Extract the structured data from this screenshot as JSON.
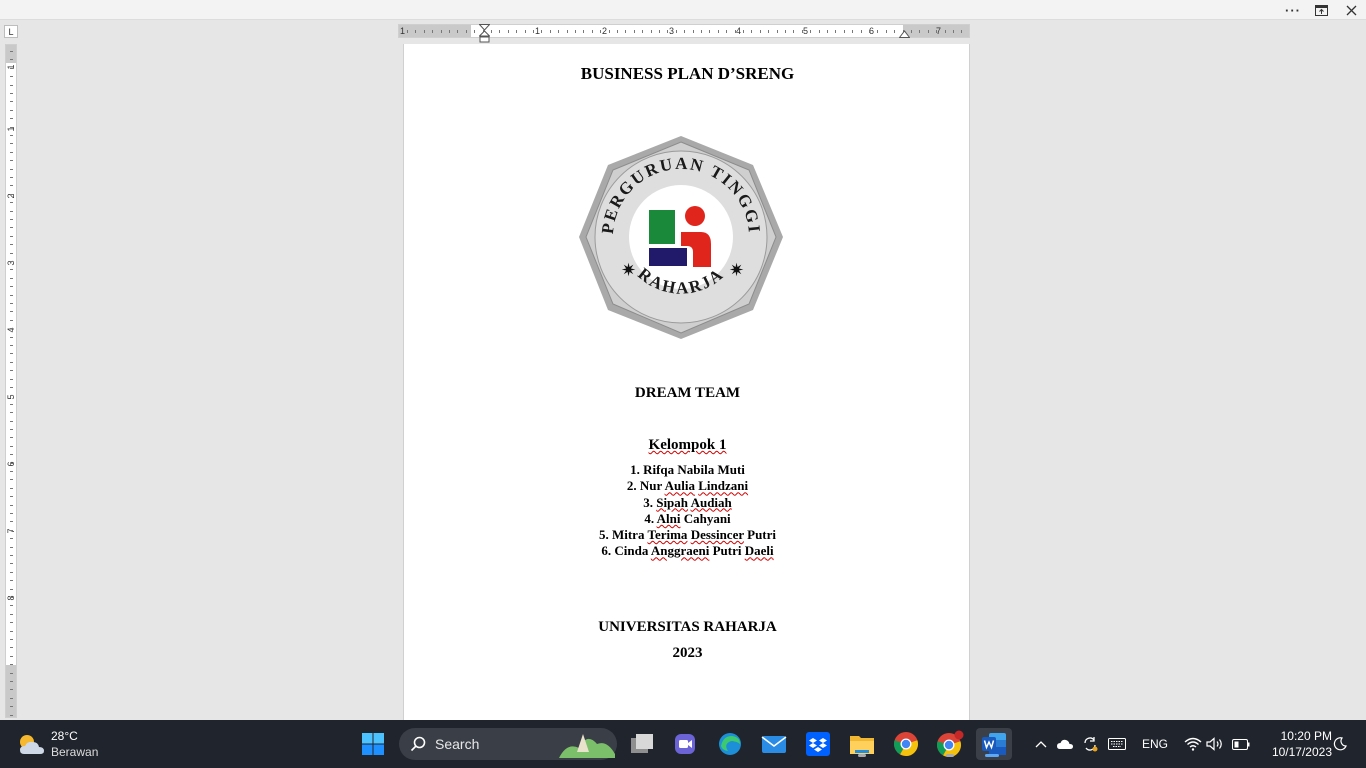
{
  "window": {
    "more_label": "···",
    "restore_icon": "restore-icon",
    "close_icon": "close-icon"
  },
  "ruler": {
    "corner_label": "L",
    "h_numbers": [
      "1",
      "1",
      "2",
      "3",
      "4",
      "5",
      "6",
      "7"
    ],
    "v_numbers": [
      "1",
      "1",
      "2",
      "3",
      "4",
      "5",
      "6",
      "7",
      "8"
    ]
  },
  "document": {
    "title": "BUSINESS PLAN D’SRENG",
    "logo": {
      "top_text": "PERGURUAN TINGGI",
      "bottom_text": "RAHARJA",
      "colors": {
        "green": "#1a8a3a",
        "red": "#e0261c",
        "navy": "#21196a",
        "ring": "#d8d8d8",
        "frame": "#a9a9a9"
      }
    },
    "team": "DREAM TEAM",
    "group": "Kelompok 1",
    "members": [
      "1.  Rifqa Nabila Muti",
      "2.  Nur Aulia Lindzani",
      "3.  Sipah Audiah",
      "4.  Alni Cahyani",
      "5.  Mitra Terima Dessincer Putri",
      "6.  Cinda Anggraeni Putri Daeli"
    ],
    "university": "UNIVERSITAS RAHARJA",
    "year": "2023"
  },
  "taskbar": {
    "weather": {
      "temp": "28°C",
      "condition": "Berawan",
      "icon": "partly-cloudy-icon"
    },
    "search_label": "Search",
    "apps": [
      "start-icon",
      "search-icon",
      "task-view-icon",
      "meet-icon",
      "edge-icon",
      "mail-icon",
      "dropbox-icon",
      "file-explorer-icon",
      "chrome-icon",
      "chrome-profile-icon",
      "word-icon"
    ],
    "tray": {
      "language": "ENG"
    },
    "clock": {
      "time": "10:20 PM",
      "date": "10/17/2023"
    }
  }
}
